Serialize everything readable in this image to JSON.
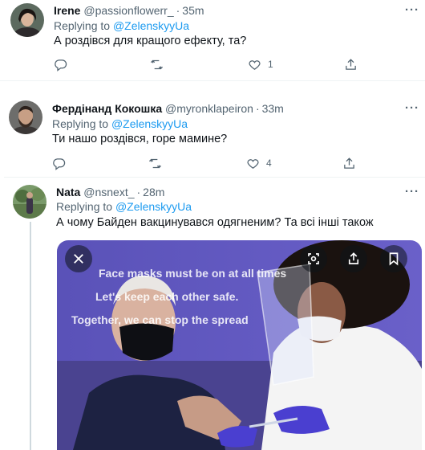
{
  "tweets": [
    {
      "name": "Irene",
      "handle": "@passionflowerr_",
      "time": "35m",
      "replying_prefix": "Replying to ",
      "replying_to": "@ZelenskyyUa",
      "text": "А роздівся для кращого ефекту, та?",
      "likes": "1"
    },
    {
      "name": "Фердінанд Кокошка",
      "handle": "@myronklapeiron",
      "time": "33m",
      "replying_prefix": "Replying to ",
      "replying_to": "@ZelenskyyUa",
      "text": "Ти нашо роздівся, горе мамине?",
      "likes": "4"
    },
    {
      "name": "Nata",
      "handle": "@nsnext_",
      "time": "28m",
      "replying_prefix": "Replying to ",
      "replying_to": "@ZelenskyyUa",
      "text": "А чому Байден вакцинувався одягненим? Та всі інші також"
    }
  ],
  "media": {
    "sign_lines": [
      "Face masks must be on at all times",
      "Let's keep each other safe.",
      "Together, we can stop the spread"
    ]
  },
  "icons": {
    "reply": "reply-icon",
    "retweet": "retweet-icon",
    "like": "heart-icon",
    "share": "share-icon",
    "more": "more-icon",
    "close": "close-icon",
    "lens": "lens-icon",
    "bookmark": "bookmark-icon"
  },
  "colors": {
    "accent": "#1d9bf0",
    "secondary_text": "#536471",
    "divider": "#eff3f4"
  }
}
